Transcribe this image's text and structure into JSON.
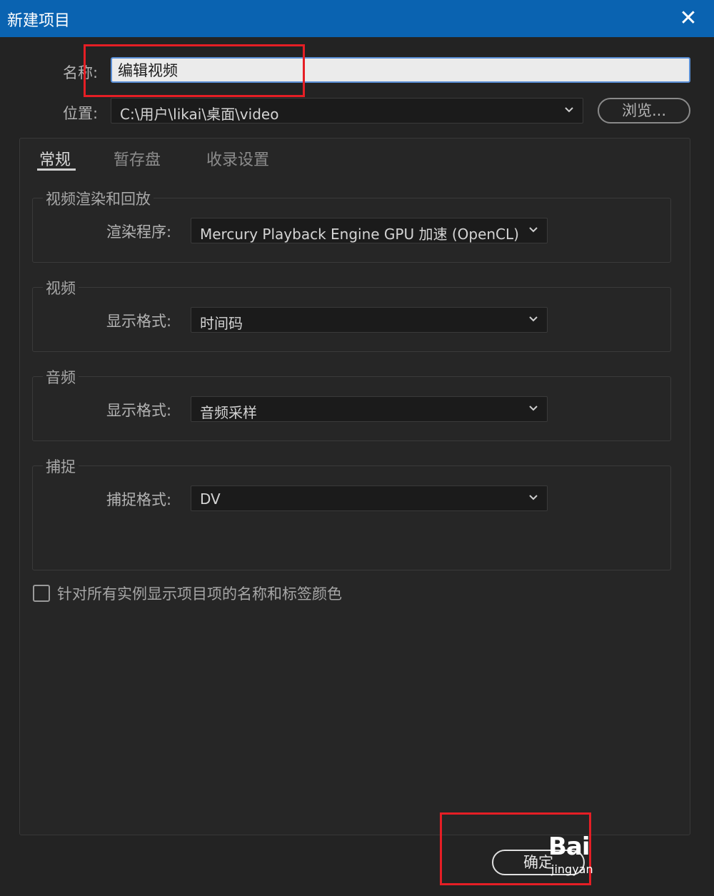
{
  "window": {
    "title": "新建项目",
    "close_glyph": "✕"
  },
  "form": {
    "name_label": "名称:",
    "name_value": "编辑视频",
    "location_label": "位置:",
    "location_value": "C:\\用户\\likai\\桌面\\video",
    "browse_label": "浏览..."
  },
  "tabs": [
    {
      "label": "常规",
      "active": true
    },
    {
      "label": "暂存盘",
      "active": false
    },
    {
      "label": "收录设置",
      "active": false
    }
  ],
  "groups": {
    "video_render": {
      "title": "视频渲染和回放",
      "field_label": "渲染程序:",
      "value": "Mercury Playback Engine GPU 加速 (OpenCL)"
    },
    "video": {
      "title": "视频",
      "field_label": "显示格式:",
      "value": "时间码"
    },
    "audio": {
      "title": "音频",
      "field_label": "显示格式:",
      "value": "音频采样"
    },
    "capture": {
      "title": "捕捉",
      "field_label": "捕捉格式:",
      "value": "DV"
    }
  },
  "checkbox": {
    "label": "针对所有实例显示项目项的名称和标签颜色",
    "checked": false
  },
  "footer": {
    "ok_label": "确定"
  },
  "watermark": {
    "main": "Bai",
    "sub": "jingyan"
  },
  "colors": {
    "titlebar": "#0a63b1",
    "annotation_red": "#e51e25",
    "background": "#232323"
  },
  "icons": {
    "dropdown": "chevron-down-icon",
    "close": "close-icon"
  }
}
